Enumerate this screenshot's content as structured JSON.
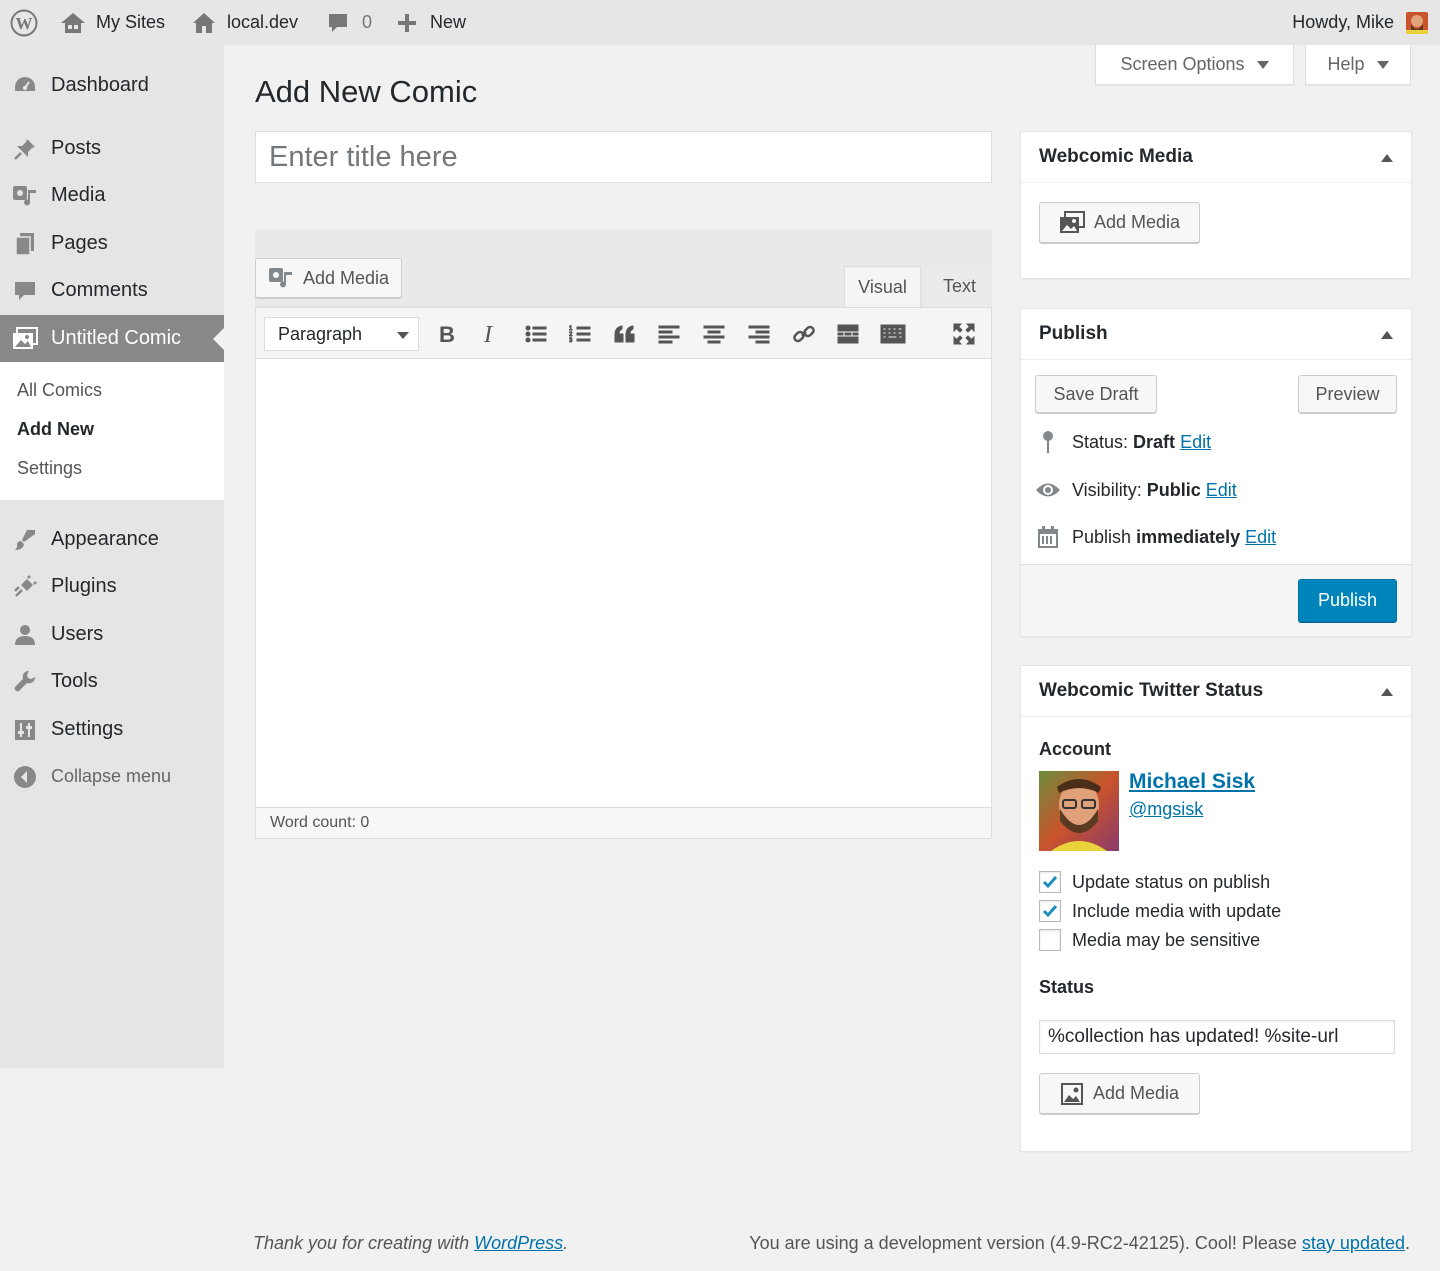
{
  "adminbar": {
    "my_sites": "My Sites",
    "site_name": "local.dev",
    "comments_count": "0",
    "new_label": "New",
    "howdy": "Howdy, Mike"
  },
  "sidebar": {
    "dashboard": "Dashboard",
    "posts": "Posts",
    "media": "Media",
    "pages": "Pages",
    "comments": "Comments",
    "current": "Untitled Comic",
    "submenu": [
      "All Comics",
      "Add New",
      "Settings"
    ],
    "appearance": "Appearance",
    "plugins": "Plugins",
    "users": "Users",
    "tools": "Tools",
    "settings": "Settings",
    "collapse": "Collapse menu"
  },
  "screen_options": "Screen Options",
  "help": "Help",
  "page_title": "Add New Comic",
  "title_placeholder": "Enter title here",
  "editor": {
    "add_media": "Add Media",
    "tab_visual": "Visual",
    "tab_text": "Text",
    "format": "Paragraph",
    "word_count": "Word count: 0"
  },
  "webcomic_media": {
    "title": "Webcomic Media",
    "add_media": "Add Media"
  },
  "publish": {
    "title": "Publish",
    "save_draft": "Save Draft",
    "preview": "Preview",
    "status_label": "Status:",
    "status_value": "Draft",
    "visibility_label": "Visibility:",
    "visibility_value": "Public",
    "publish_label": "Publish",
    "publish_value": "immediately",
    "edit": "Edit",
    "publish_button": "Publish"
  },
  "twitter": {
    "title": "Webcomic Twitter Status",
    "account_label": "Account",
    "name": "Michael Sisk",
    "handle": "@mgsisk",
    "options": [
      {
        "label": "Update status on publish",
        "checked": true
      },
      {
        "label": "Include media with update",
        "checked": true
      },
      {
        "label": "Media may be sensitive",
        "checked": false
      }
    ],
    "status_label": "Status",
    "status_value": "%collection has updated! %site-url",
    "add_media": "Add Media"
  },
  "footer": {
    "thanks_prefix": "Thank you for creating with ",
    "wordpress": "WordPress",
    "thanks_suffix": ".",
    "version_text": "You are using a development version (4.9-RC2-42125). Cool! Please ",
    "stay_updated": "stay updated",
    "version_suffix": "."
  }
}
